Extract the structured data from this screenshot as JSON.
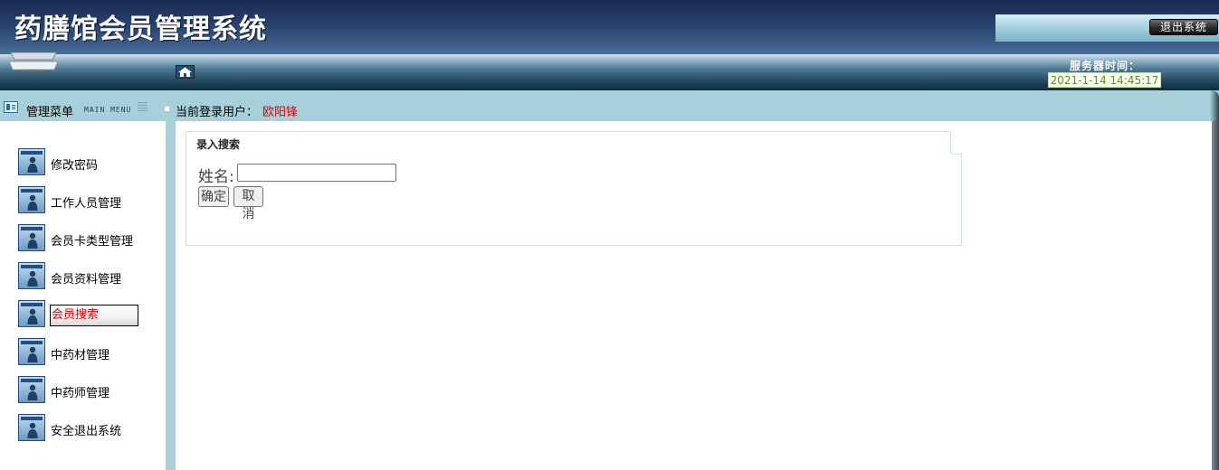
{
  "header": {
    "title": "药膳馆会员管理系统",
    "logout_label": "退出系统"
  },
  "navbar": {
    "server_time_label": "服务器时间：",
    "server_time": "2021-1-14 14:45:17"
  },
  "infobar": {
    "menu_title": "管理菜单",
    "menu_title_en": "MAIN MENU",
    "current_user_label": "当前登录用户：",
    "current_user_name": "欧阳锋"
  },
  "sidebar": {
    "items": [
      {
        "label": "修改密码"
      },
      {
        "label": "工作人员管理"
      },
      {
        "label": "会员卡类型管理"
      },
      {
        "label": "会员资料管理"
      },
      {
        "label": "会员搜索"
      },
      {
        "label": "中药材管理"
      },
      {
        "label": "中药师管理"
      },
      {
        "label": "安全退出系统"
      }
    ],
    "active_item": "会员搜索"
  },
  "search": {
    "tab_title": "录入搜索",
    "name_label": "姓名:",
    "name_value": "",
    "confirm_label": "确定",
    "cancel_label": "取消"
  },
  "colors": {
    "header_bg": "#27406d",
    "infobar_bg": "#a8d0da",
    "active_text": "#e00000",
    "time_text": "#5c8f2a"
  }
}
